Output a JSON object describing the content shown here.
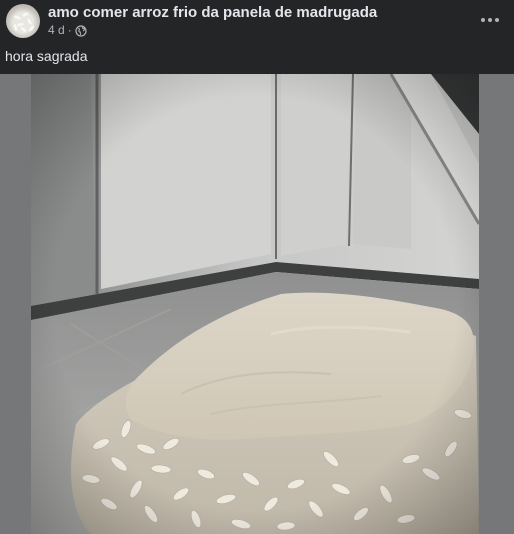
{
  "post": {
    "group_name": "amo comer arroz frio da panela de madrugada",
    "time": "4 d",
    "separator": "·",
    "caption": "hora sagrada",
    "audience_icon": "globe-icon",
    "more_icon": "more-horizontal-icon"
  },
  "photo": {
    "subject": "rice-photo"
  },
  "colors": {
    "background": "#242526",
    "primary_text": "#e4e6eb",
    "secondary_text": "#b0b3b8",
    "photo_side_bars": "#757778"
  }
}
